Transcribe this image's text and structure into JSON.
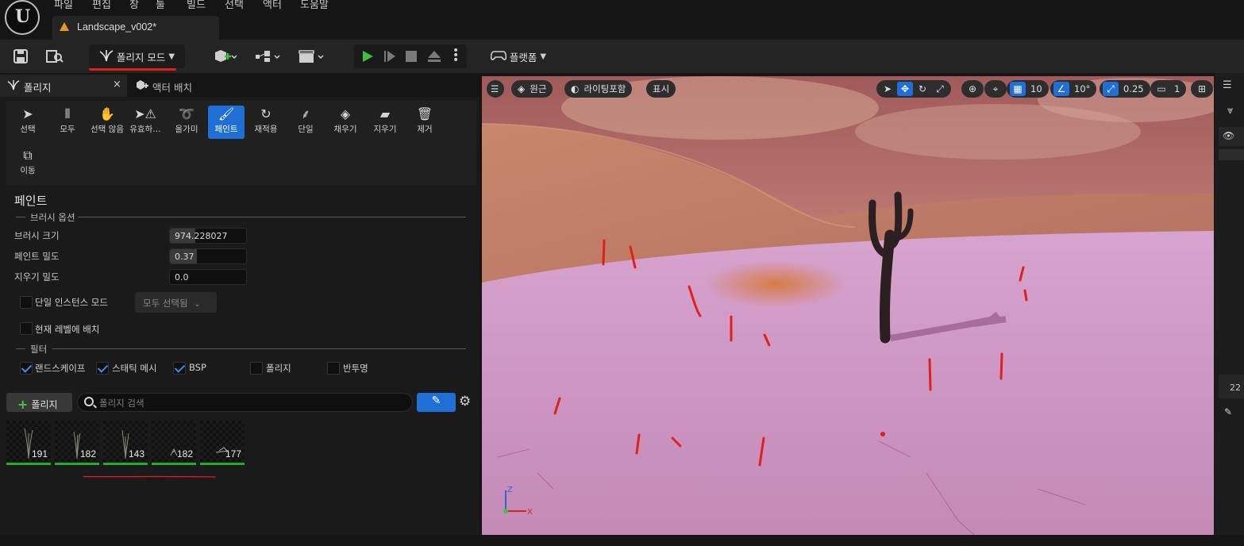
{
  "menu": {
    "items": [
      "파일",
      "편집",
      "창",
      "툴",
      "빌드",
      "선택",
      "액터",
      "도움말"
    ]
  },
  "document_tab": {
    "title": "Landscape_v002*"
  },
  "toolbar": {
    "mode_label": "폴리지 모드",
    "platform_label": "플랫폼"
  },
  "panel_tabs": {
    "foliage": "폴리지",
    "close": "×",
    "place_actors": "액터 배치"
  },
  "tools": [
    {
      "label": "선택",
      "icon": "select-arrow-icon"
    },
    {
      "label": "모두",
      "icon": "select-all-icon"
    },
    {
      "label": "선택 않음",
      "icon": "deselect-hand-icon"
    },
    {
      "label": "유효하…",
      "icon": "select-invalid-icon"
    },
    {
      "label": "올가미",
      "icon": "lasso-icon"
    },
    {
      "label": "페인트",
      "icon": "paint-brush-icon",
      "active": true
    },
    {
      "label": "재적용",
      "icon": "reapply-icon"
    },
    {
      "label": "단일",
      "icon": "single-foliage-icon"
    },
    {
      "label": "채우기",
      "icon": "fill-bucket-icon"
    },
    {
      "label": "지우기",
      "icon": "eraser-icon"
    },
    {
      "label": "제거",
      "icon": "trash-icon"
    },
    {
      "label": "이동",
      "icon": "move-layers-icon"
    }
  ],
  "paint": {
    "section_title": "페인트",
    "brush_group": "브러시 옵션",
    "brush_size_label": "브러시 크기",
    "brush_size_value": "974.228027",
    "paint_density_label": "페인트 밀도",
    "paint_density_value": "0.37",
    "erase_density_label": "지우기 밀도",
    "erase_density_value": "0.0",
    "single_instance_label": "단일 인스턴스 모드",
    "single_instance_checked": false,
    "select_all_label": "모두 선택됨",
    "place_current_level_label": "현재 레벨에 배치",
    "place_current_level_checked": false,
    "filter_group": "필터",
    "filters": [
      {
        "label": "랜드스케이프",
        "checked": true
      },
      {
        "label": "스태틱 메시",
        "checked": true
      },
      {
        "label": "BSP",
        "checked": true
      },
      {
        "label": "폴리지",
        "checked": false
      },
      {
        "label": "반투명",
        "checked": false
      }
    ]
  },
  "foliage_list": {
    "add_label": "폴리지",
    "search_placeholder": "폴리지 검색",
    "items": [
      {
        "count": "191"
      },
      {
        "count": "182"
      },
      {
        "count": "143"
      },
      {
        "count": "182"
      },
      {
        "count": "177"
      }
    ]
  },
  "viewport": {
    "perspective_label": "원근",
    "lighting_label": "라이팅포함",
    "show_label": "표시",
    "grid_snap_value": "10",
    "rotation_snap_value": "10°",
    "scale_snap_value": "0.25",
    "camera_speed_value": "1",
    "axis_labels": {
      "z": "Z",
      "x": "X"
    }
  },
  "right_panel": {
    "value_fragment": "22"
  },
  "colors": {
    "accent": "#1f6fd6",
    "annotation_red": "#e0201b",
    "warning": "#e59a1c",
    "play_green": "#39c33b",
    "ground_pink": "#c889b8"
  }
}
